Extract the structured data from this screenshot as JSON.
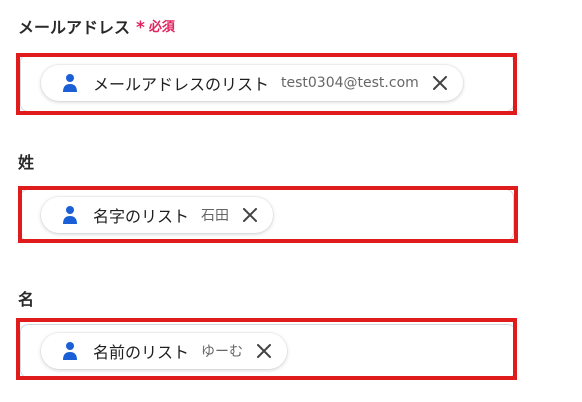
{
  "fields": [
    {
      "label": "メールアドレス",
      "required_mark": "*",
      "required_text": "必須",
      "chip": {
        "icon": "person-icon",
        "label": "メールアドレスのリスト",
        "value": "test0304@test.com",
        "remove_icon": "close-icon"
      }
    },
    {
      "label": "姓",
      "chip": {
        "icon": "person-icon",
        "label": "名字のリスト",
        "value": "石田",
        "remove_icon": "close-icon"
      }
    },
    {
      "label": "名",
      "chip": {
        "icon": "person-icon",
        "label": "名前のリスト",
        "value": "ゆーむ",
        "remove_icon": "close-icon"
      }
    }
  ],
  "colors": {
    "required": "#e0245e",
    "highlight": "#e01b1b",
    "icon_blue": "#1a5fd6"
  }
}
